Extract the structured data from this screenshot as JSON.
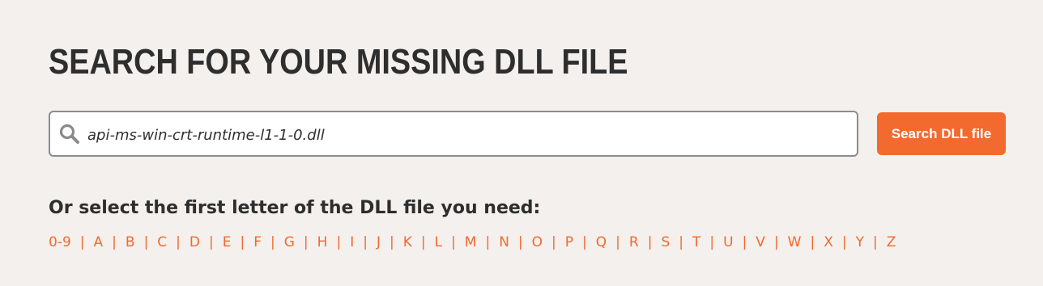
{
  "header": {
    "title": "SEARCH FOR YOUR MISSING DLL FILE"
  },
  "search": {
    "value": "api-ms-win-crt-runtime-l1-1-0.dll",
    "icon": "search-icon",
    "button_label": "Search DLL file"
  },
  "letters": {
    "heading": "Or select the first letter of the DLL file you need:",
    "items": [
      "0-9",
      "A",
      "B",
      "C",
      "D",
      "E",
      "F",
      "G",
      "H",
      "I",
      "J",
      "K",
      "L",
      "M",
      "N",
      "O",
      "P",
      "Q",
      "R",
      "S",
      "T",
      "U",
      "V",
      "W",
      "X",
      "Y",
      "Z"
    ],
    "separator": "|"
  },
  "colors": {
    "background": "#f3f0ed",
    "accent": "#f26a2e",
    "text": "#2e2e2e",
    "input_border": "#8c8c8c"
  }
}
